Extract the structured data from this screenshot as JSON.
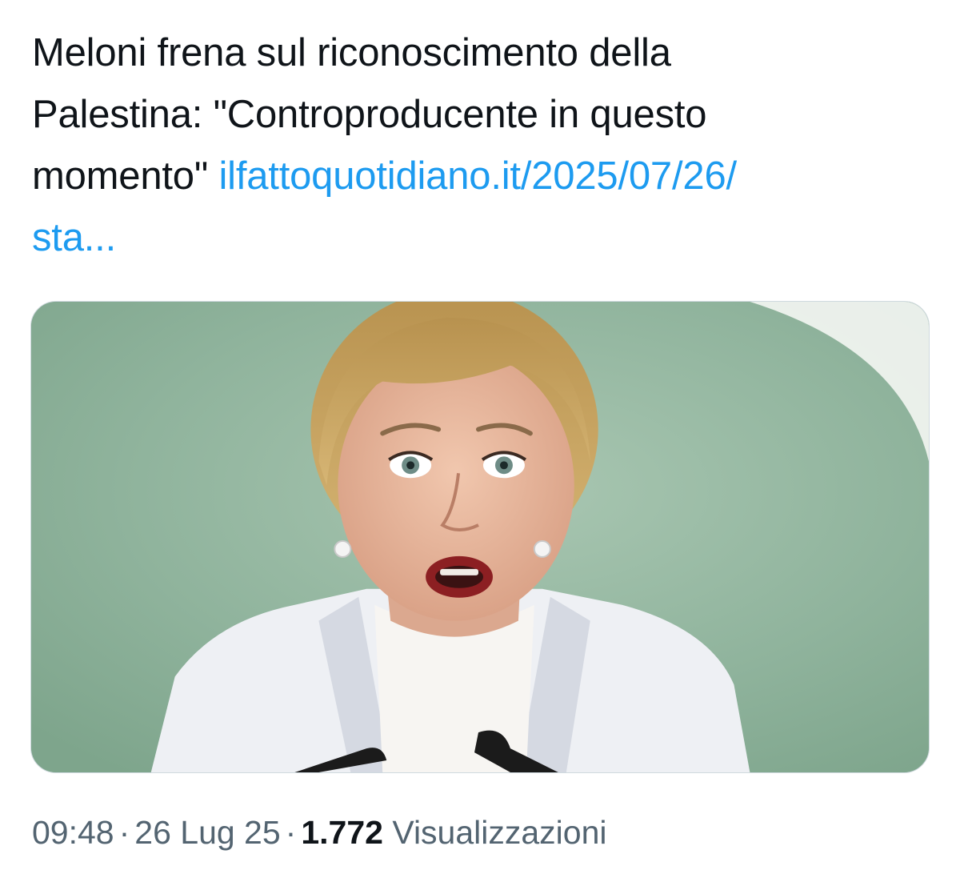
{
  "tweet": {
    "text_line1": "Meloni frena sul riconoscimento della",
    "text_line2": "Palestina: \"Controproducente in questo",
    "text_line3": "momento\" ",
    "link_text": "ilfattoquotidiano.it/2025/07/26/",
    "link_text_cont": "sta..."
  },
  "media": {
    "description_icon": "photo",
    "colors": {
      "background_green": "#8fb39c",
      "jacket_white": "#eef0f4",
      "hair": "#c9a566",
      "skin": "#e8b59b",
      "lips": "#8c1f22"
    }
  },
  "meta": {
    "time": "09:48",
    "date": "26 Lug 25",
    "views_count": "1.772",
    "views_label": "Visualizzazioni",
    "separator": "·"
  },
  "colors": {
    "text": "#0f1419",
    "link": "#1d9bf0",
    "secondary": "#536471"
  }
}
